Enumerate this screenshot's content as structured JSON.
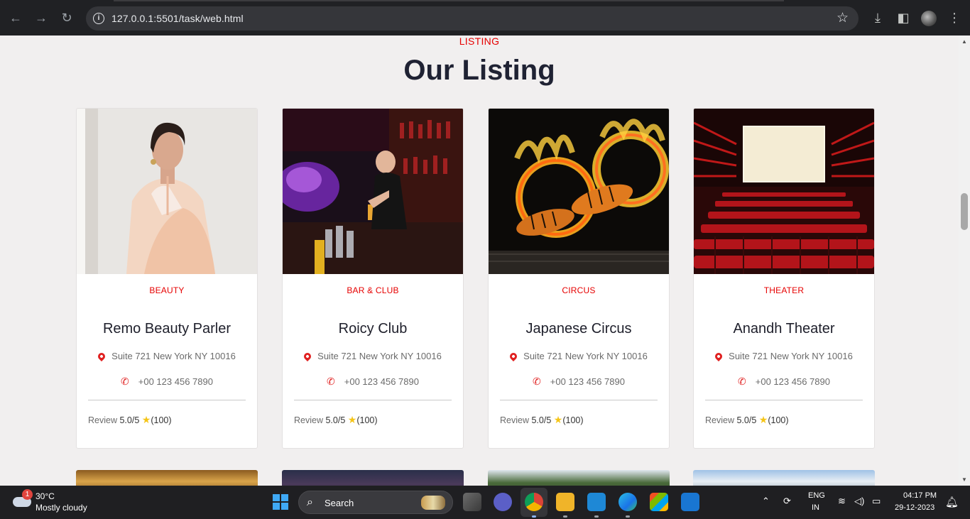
{
  "browser": {
    "url": "127.0.0.1:5501/task/web.html",
    "icons": [
      "back-icon",
      "forward-icon",
      "reload-icon",
      "info-icon",
      "star-icon",
      "download-icon",
      "sidepanel-icon",
      "profile-avatar",
      "menu-icon"
    ]
  },
  "section": {
    "tag": "LISTING",
    "title": "Our Listing"
  },
  "listings": [
    {
      "category": "BEAUTY",
      "name": "Remo Beauty Parler",
      "address": "Suite 721 New York NY 10016",
      "phone": "+00 123 456 7890",
      "review_label": "Review",
      "score": "5.0/5",
      "star": "★",
      "count": "(100)",
      "photo": "portrait of woman in peach saree"
    },
    {
      "category": "BAR & CLUB",
      "name": "Roicy Club",
      "address": "Suite 721 New York NY 10016",
      "phone": "+00 123 456 7890",
      "review_label": "Review",
      "score": "5.0/5",
      "star": "★",
      "count": "(100)",
      "photo": "bartender pouring beer in neon bar"
    },
    {
      "category": "CIRCUS",
      "name": "Japanese Circus",
      "address": "Suite 721 New York NY 10016",
      "phone": "+00 123 456 7890",
      "review_label": "Review",
      "score": "5.0/5",
      "star": "★",
      "count": "(100)",
      "photo": "tigers jumping through fire rings"
    },
    {
      "category": "THEATER",
      "name": "Anandh Theater",
      "address": "Suite 721 New York NY 10016",
      "phone": "+00 123 456 7890",
      "review_label": "Review",
      "score": "5.0/5",
      "star": "★",
      "count": "(100)",
      "photo": "cinema hall with red seats"
    }
  ],
  "taskbar": {
    "weather_badge": "1",
    "temperature": "30°C",
    "weather": "Mostly cloudy",
    "search_label": "Search",
    "lang_line1": "ENG",
    "lang_line2": "IN",
    "time": "04:17 PM",
    "date": "29-12-2023"
  },
  "colors": {
    "accent": "#e60000",
    "title": "#1f2233",
    "page_bg": "#f1efef",
    "star": "#f5c518"
  }
}
